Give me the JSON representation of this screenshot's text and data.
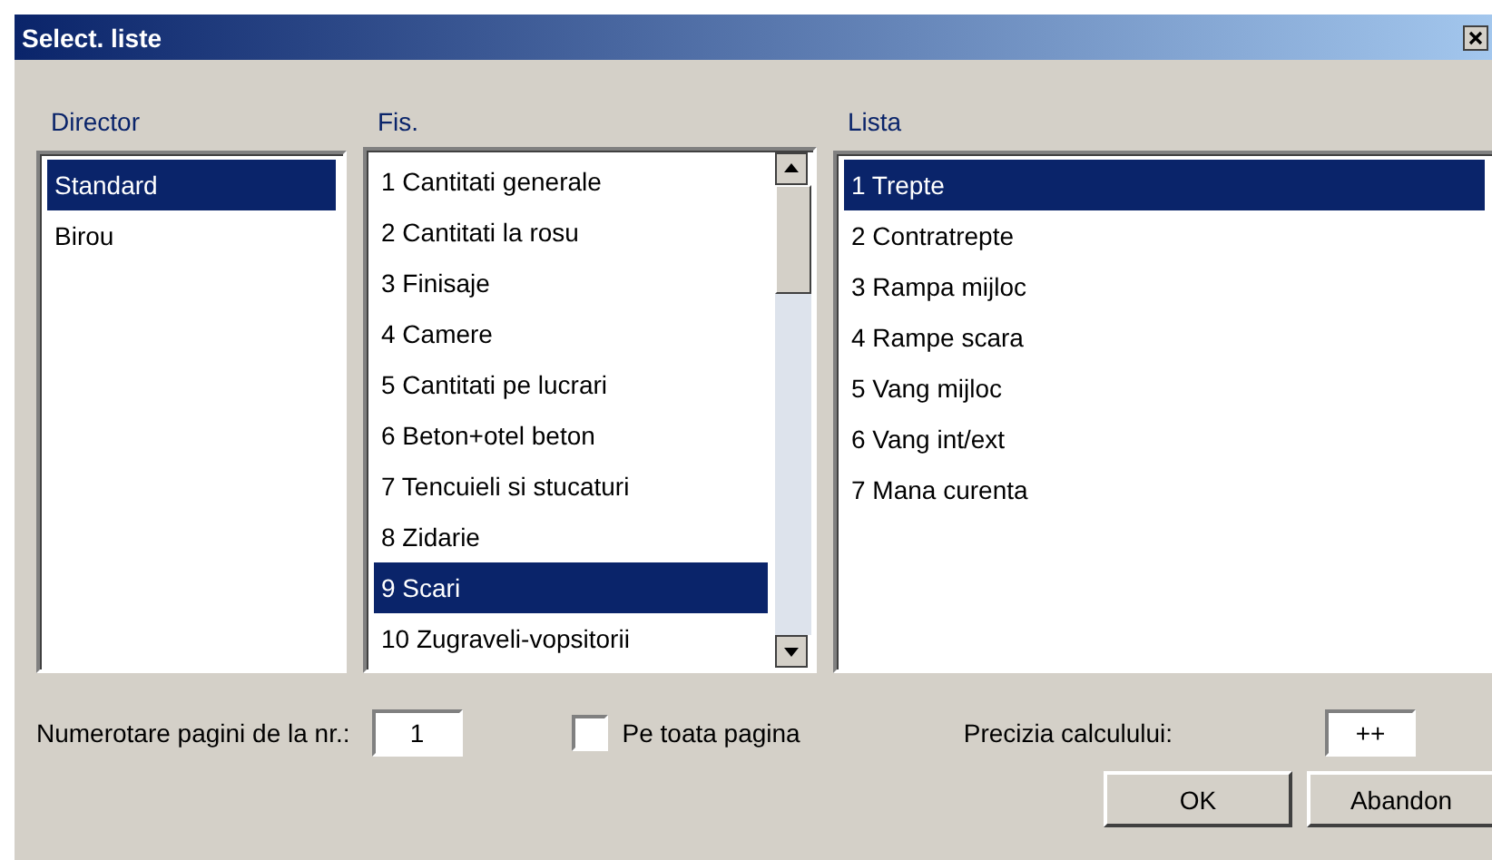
{
  "window": {
    "title": "Select. liste"
  },
  "director": {
    "label": "Director",
    "items": [
      {
        "text": "Standard",
        "selected": true
      },
      {
        "text": "Birou",
        "selected": false
      }
    ]
  },
  "fis": {
    "label": "Fis.",
    "items": [
      {
        "text": "1 Cantitati generale",
        "selected": false
      },
      {
        "text": "2 Cantitati la rosu",
        "selected": false
      },
      {
        "text": "3 Finisaje",
        "selected": false
      },
      {
        "text": "4 Camere",
        "selected": false
      },
      {
        "text": "5 Cantitati pe lucrari",
        "selected": false
      },
      {
        "text": "6 Beton+otel beton",
        "selected": false
      },
      {
        "text": "7 Tencuieli si stucaturi",
        "selected": false
      },
      {
        "text": "8 Zidarie",
        "selected": false
      },
      {
        "text": "9 Scari",
        "selected": true
      },
      {
        "text": "10 Zugraveli-vopsitorii",
        "selected": false
      }
    ]
  },
  "lista": {
    "label": "Lista",
    "items": [
      {
        "text": "1 Trepte",
        "selected": true
      },
      {
        "text": "2 Contratrepte",
        "selected": false
      },
      {
        "text": "3 Rampa mijloc",
        "selected": false
      },
      {
        "text": "4 Rampe scara",
        "selected": false
      },
      {
        "text": "5 Vang mijloc",
        "selected": false
      },
      {
        "text": "6 Vang int/ext",
        "selected": false
      },
      {
        "text": "7 Mana curenta",
        "selected": false
      }
    ]
  },
  "numbering": {
    "label": "Numerotare pagini de la nr.:",
    "value": "1"
  },
  "full_page": {
    "label": "Pe toata pagina",
    "checked": false
  },
  "precision": {
    "label": "Precizia calculului:",
    "value": "++"
  },
  "buttons": [
    "OK",
    "Abandon"
  ]
}
